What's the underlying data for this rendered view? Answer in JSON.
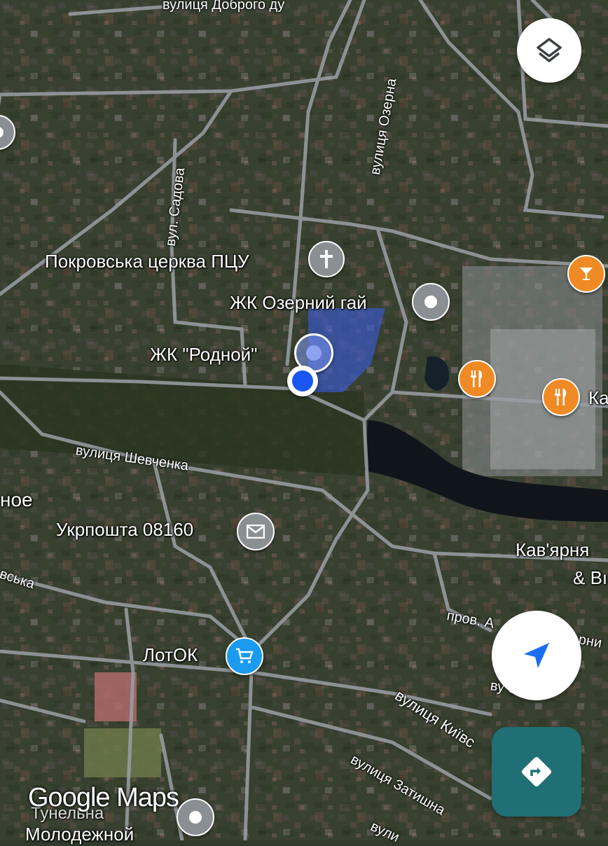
{
  "map": {
    "places": {
      "church": "Покровська церква ПЦУ",
      "ozerny": "ЖК Озерний гай",
      "rodnoy": "ЖК \"Родной\"",
      "post": "Укрпошта 08160",
      "lotok": "ЛотОК",
      "cafe_line1": "Кав'ярня",
      "cafe_line2": "& Bı",
      "k_edge": "Ка",
      "noe_edge": "ное",
      "molodezh": "Молодежной",
      "zatyshna_label": "Тунельна"
    },
    "streets": {
      "dobroho": "вулиця Доброго ду",
      "ozerna": "вулиця Озерна",
      "sadova": "вул. Садова",
      "shevchenka": "вулиця Шевченка",
      "kyivska_left": "вська",
      "prov": "пров. А",
      "prov_right": "рни",
      "kyivska": "вулиця Київс",
      "zatyshna": "вулиця Затишна",
      "vu_ova": "ву ова",
      "bottom": "вули"
    },
    "icons": {
      "layers": "layers-icon",
      "church": "cross-icon",
      "place": "place-pin-icon",
      "bar": "cocktail-icon",
      "restaurant": "fork-knife-icon",
      "post": "envelope-icon",
      "shop": "cart-icon",
      "navigate": "navigation-arrow-icon",
      "directions": "directions-icon"
    },
    "colors": {
      "location_dot": "#1a56f0",
      "food_pin": "#f08a24",
      "grey_pin": "#8a8f94",
      "shop_pin": "#1a9bf0",
      "directions_bg": "#1f6f75",
      "nav_arrow": "#1a6ff0"
    }
  },
  "branding": {
    "logo": "Google Maps"
  }
}
